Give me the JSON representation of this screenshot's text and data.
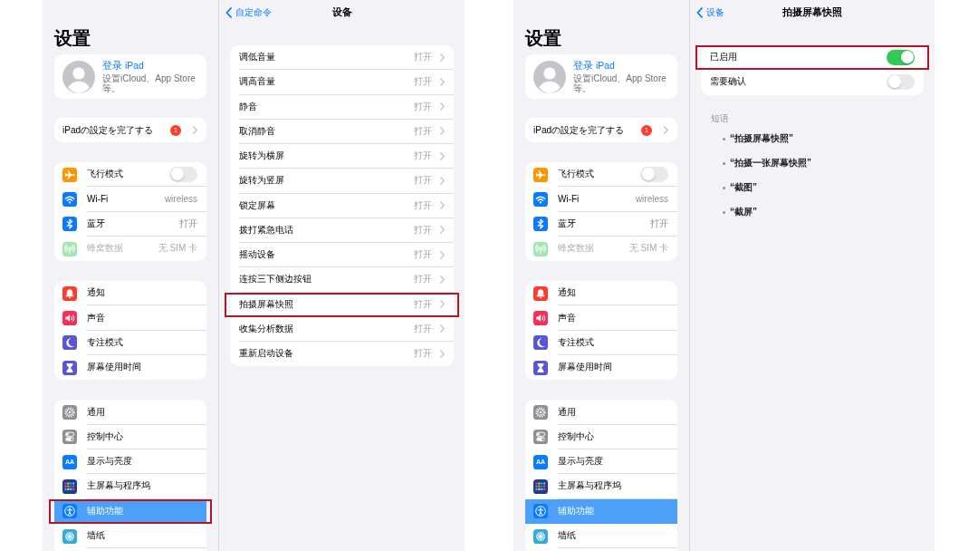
{
  "screens": [
    {
      "sidebar": {
        "title": "设置",
        "account": {
          "name": "登录 iPad",
          "subtitle": "设置iCloud、App Store等。"
        },
        "setup": {
          "label": "iPadの設定を完了する",
          "badge": "1"
        },
        "groups": [
          [
            {
              "kind": "toggle",
              "label": "飞行模式",
              "on": false,
              "disabled": false,
              "selected": false,
              "highlighted": false
            },
            {
              "kind": "value",
              "label": "Wi-Fi",
              "value": "wireless",
              "disabled": false,
              "selected": false,
              "highlighted": false
            },
            {
              "kind": "value",
              "label": "蓝牙",
              "value": "打开",
              "disabled": false,
              "selected": false,
              "highlighted": false
            },
            {
              "kind": "value",
              "label": "蜂窝数据",
              "value": "无 SIM 卡",
              "disabled": true,
              "selected": false,
              "highlighted": false
            }
          ],
          [
            {
              "kind": "plain",
              "label": "通知",
              "selected": false,
              "highlighted": false
            },
            {
              "kind": "plain",
              "label": "声音",
              "selected": false,
              "highlighted": false
            },
            {
              "kind": "plain",
              "label": "专注模式",
              "selected": false,
              "highlighted": false
            },
            {
              "kind": "plain",
              "label": "屏幕使用时间",
              "selected": false,
              "highlighted": false
            }
          ],
          [
            {
              "kind": "plain",
              "label": "通用",
              "selected": false,
              "highlighted": false
            },
            {
              "kind": "plain",
              "label": "控制中心",
              "selected": false,
              "highlighted": false
            },
            {
              "kind": "plain",
              "label": "显示与亮度",
              "icon_text": "AA",
              "selected": false,
              "highlighted": false
            },
            {
              "kind": "plain",
              "label": "主屏幕与程序坞",
              "selected": false,
              "highlighted": false
            },
            {
              "kind": "plain",
              "label": "辅助功能",
              "selected": true,
              "highlighted": true
            },
            {
              "kind": "plain",
              "label": "墙纸",
              "selected": false,
              "highlighted": false
            }
          ]
        ]
      },
      "detail": {
        "back": "自定命令",
        "title": "设备",
        "rows": [
          {
            "kind": "link",
            "label": "调低音量",
            "value": "打开",
            "highlighted": false
          },
          {
            "kind": "link",
            "label": "调高音量",
            "value": "打开",
            "highlighted": false
          },
          {
            "kind": "link",
            "label": "静音",
            "value": "打开",
            "highlighted": false
          },
          {
            "kind": "link",
            "label": "取消静音",
            "value": "打开",
            "highlighted": false
          },
          {
            "kind": "link",
            "label": "旋转为横屏",
            "value": "打开",
            "highlighted": false
          },
          {
            "kind": "link",
            "label": "旋转为竖屏",
            "value": "打开",
            "highlighted": false
          },
          {
            "kind": "link",
            "label": "锁定屏幕",
            "value": "打开",
            "highlighted": false
          },
          {
            "kind": "link",
            "label": "拨打紧急电话",
            "value": "打开",
            "highlighted": false
          },
          {
            "kind": "link",
            "label": "摇动设备",
            "value": "打开",
            "highlighted": false
          },
          {
            "kind": "link",
            "label": "连按三下侧边按钮",
            "value": "打开",
            "highlighted": false
          },
          {
            "kind": "link",
            "label": "拍摄屏幕快照",
            "value": "打开",
            "highlighted": true
          },
          {
            "kind": "link",
            "label": "收集分析数据",
            "value": "打开",
            "highlighted": false
          },
          {
            "kind": "link",
            "label": "重新启动设备",
            "value": "打开",
            "highlighted": false
          }
        ]
      }
    },
    {
      "sidebar": {
        "title": "设置",
        "account": {
          "name": "登录 iPad",
          "subtitle": "设置iCloud、App Store等。"
        },
        "setup": {
          "label": "iPadの設定を完了する",
          "badge": "1"
        },
        "groups": [
          [
            {
              "kind": "toggle",
              "label": "飞行模式",
              "on": false,
              "disabled": false,
              "selected": false,
              "highlighted": false
            },
            {
              "kind": "value",
              "label": "Wi-Fi",
              "value": "wireless",
              "disabled": false,
              "selected": false,
              "highlighted": false
            },
            {
              "kind": "value",
              "label": "蓝牙",
              "value": "打开",
              "disabled": false,
              "selected": false,
              "highlighted": false
            },
            {
              "kind": "value",
              "label": "蜂窝数据",
              "value": "无 SIM 卡",
              "disabled": true,
              "selected": false,
              "highlighted": false
            }
          ],
          [
            {
              "kind": "plain",
              "label": "通知",
              "selected": false,
              "highlighted": false
            },
            {
              "kind": "plain",
              "label": "声音",
              "selected": false,
              "highlighted": false
            },
            {
              "kind": "plain",
              "label": "专注模式",
              "selected": false,
              "highlighted": false
            },
            {
              "kind": "plain",
              "label": "屏幕使用时间",
              "selected": false,
              "highlighted": false
            }
          ],
          [
            {
              "kind": "plain",
              "label": "通用",
              "selected": false,
              "highlighted": false
            },
            {
              "kind": "plain",
              "label": "控制中心",
              "selected": false,
              "highlighted": false
            },
            {
              "kind": "plain",
              "label": "显示与亮度",
              "icon_text": "AA",
              "selected": false,
              "highlighted": false
            },
            {
              "kind": "plain",
              "label": "主屏幕与程序坞",
              "selected": false,
              "highlighted": false
            },
            {
              "kind": "plain",
              "label": "辅助功能",
              "selected": true,
              "highlighted": false
            },
            {
              "kind": "plain",
              "label": "墙纸",
              "selected": false,
              "highlighted": false
            }
          ]
        ]
      },
      "detail": {
        "back": "设备",
        "title": "拍摄屏幕快照",
        "rows": [
          {
            "kind": "toggle",
            "label": "已启用",
            "on": true,
            "highlighted": true
          },
          {
            "kind": "toggle",
            "label": "需要确认",
            "on": false,
            "highlighted": false
          }
        ],
        "section": {
          "header": "短语",
          "phrases": [
            "“拍摄屏幕快照”",
            "“拍摄一张屏幕快照”",
            "“截图”",
            "“截屏”"
          ]
        }
      }
    }
  ]
}
